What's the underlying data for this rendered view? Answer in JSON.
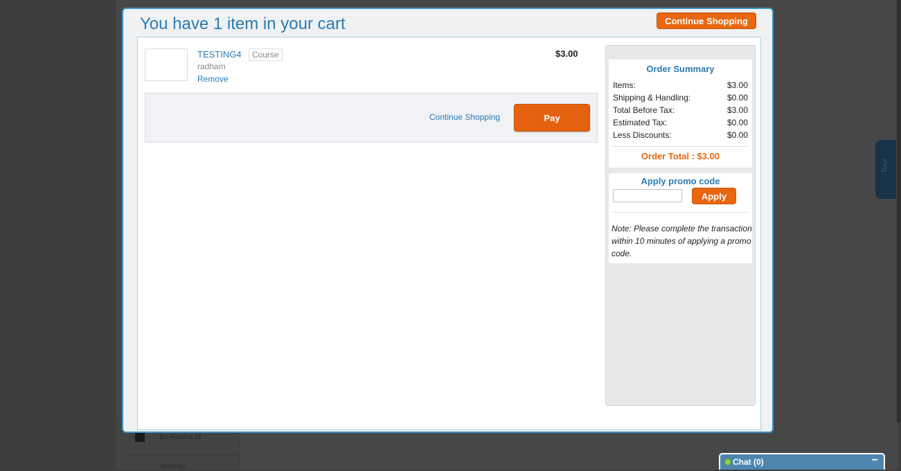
{
  "background": {
    "items": [
      {
        "label": "By Radha M"
      },
      {
        "label": "Testing1"
      }
    ],
    "tour_tab": {
      "label": "Tour"
    }
  },
  "modal": {
    "title": "You have 1 item in your cart",
    "top_continue_label": "Continue Shopping",
    "cart_items": [
      {
        "name": "TESTING4",
        "type": "Course",
        "author": "radham",
        "remove_label": "Remove",
        "price": "$3.00"
      }
    ],
    "bar_continue_label": "Continue Shopping",
    "pay_label": "Pay"
  },
  "summary": {
    "title": "Order Summary",
    "rows": [
      {
        "label": "Items:",
        "value": "$3.00"
      },
      {
        "label": "Shipping & Handling:",
        "value": "$0.00"
      },
      {
        "label": "Total Before Tax:",
        "value": "$3.00"
      },
      {
        "label": "Estimated Tax:",
        "value": "$0.00"
      },
      {
        "label": "Less Discounts:",
        "value": "$0.00"
      }
    ],
    "order_total": "Order Total : $3.00"
  },
  "promo": {
    "title": "Apply promo code",
    "input_value": "",
    "apply_label": "Apply",
    "note": "Note: Please complete the transaction within 10 minutes of applying a promo code."
  },
  "chat": {
    "label": "Chat  (0)",
    "minimize_symbol": "−",
    "status_color": "#8fd14f"
  },
  "colors": {
    "accent_blue": "#2a7ab5",
    "button_orange": "#e8670f",
    "modal_border": "#3d95c8"
  }
}
